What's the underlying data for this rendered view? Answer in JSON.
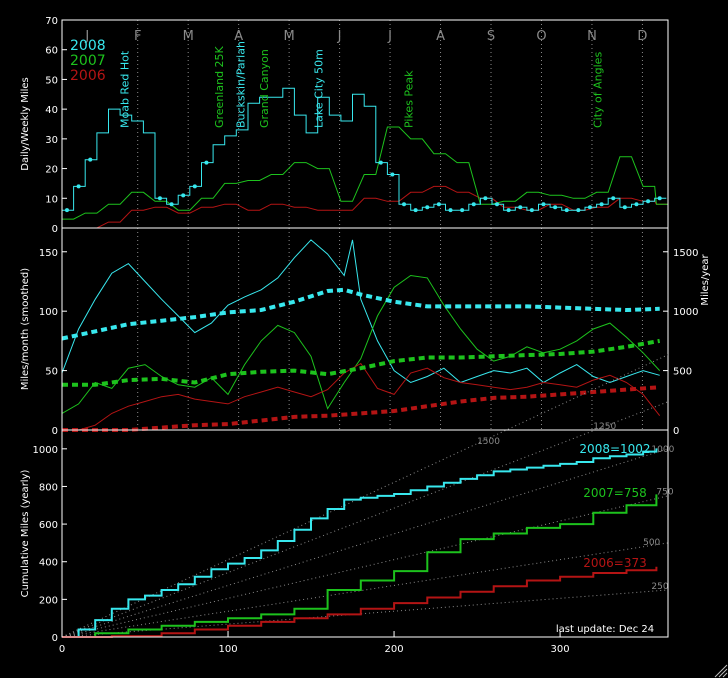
{
  "colors": {
    "background": "#000000",
    "axes": "#ffffff",
    "grid": "#8a8a8a",
    "y2008": "#38e8ee",
    "y2007": "#1dc21d",
    "y2006": "#b41414",
    "pace_lines": "#8a8a8a"
  },
  "panel1": {
    "ylabel": "Daily/Weekly Miles",
    "ylim": [
      0,
      70
    ],
    "yticks": [
      0,
      10,
      20,
      30,
      40,
      50,
      60,
      70
    ],
    "months": [
      "J",
      "F",
      "M",
      "A",
      "M",
      "J",
      "J",
      "A",
      "S",
      "O",
      "N",
      "D"
    ],
    "legend": [
      "2008",
      "2007",
      "2006"
    ],
    "events": [
      {
        "day": 40,
        "label": "Moab Red Hot",
        "year": "2008"
      },
      {
        "day": 97,
        "label": "Greenland 25K",
        "year": "2007"
      },
      {
        "day": 110,
        "label": "Buckskin/Pariah",
        "year": "2008"
      },
      {
        "day": 124,
        "label": "Grand Canyon",
        "year": "2007"
      },
      {
        "day": 157,
        "label": "Lake City 50m",
        "year": "2008"
      },
      {
        "day": 211,
        "label": "Pikes Peak",
        "year": "2007"
      },
      {
        "day": 325,
        "label": "City of Angles",
        "year": "2007"
      }
    ]
  },
  "panel2": {
    "ylabel": "Miles/month (smoothed)",
    "ylabel_right": "Miles/year",
    "ylim": [
      0,
      170
    ],
    "yticks": [
      0,
      50,
      100,
      150
    ],
    "ylim_right": [
      0,
      1700
    ],
    "yticks_right": [
      0,
      500,
      1000,
      1500
    ]
  },
  "panel3": {
    "ylabel": "Cumulative Miles (yearly)",
    "ylim": [
      0,
      1100
    ],
    "yticks": [
      0,
      200,
      400,
      600,
      800,
      1000
    ],
    "totals": [
      "2008=1002",
      "2007=758",
      "2006=373"
    ],
    "pace_labels": [
      "1500",
      "1250",
      "1000",
      "750",
      "500",
      "250"
    ],
    "update_text": "last update: Dec 24"
  },
  "xaxis": {
    "xlim": [
      0,
      365
    ],
    "xticks": [
      0,
      100,
      200,
      300
    ]
  },
  "chart_data": [
    {
      "type": "line",
      "ylabel": "Daily/Weekly Miles",
      "xlim": [
        0,
        365
      ],
      "ylim": [
        0,
        70
      ],
      "series": [
        {
          "name": "2008",
          "x": [
            0,
            7,
            14,
            21,
            28,
            35,
            42,
            49,
            56,
            63,
            70,
            77,
            84,
            91,
            98,
            105,
            112,
            119,
            126,
            133,
            140,
            147,
            154,
            161,
            168,
            175,
            182,
            189,
            196,
            203,
            210,
            217,
            224,
            231,
            238,
            245,
            252,
            259,
            266,
            273,
            280,
            287,
            294,
            301,
            308,
            315,
            322,
            329,
            336,
            343,
            350,
            357
          ],
          "values": [
            6,
            14,
            23,
            32,
            40,
            38,
            36,
            32,
            10,
            8,
            11,
            14,
            22,
            28,
            31,
            33,
            42,
            44,
            44,
            47,
            38,
            32,
            44,
            38,
            36,
            45,
            41,
            22,
            18,
            8,
            6,
            7,
            8,
            6,
            6,
            8,
            10,
            8,
            6,
            7,
            6,
            8,
            7,
            6,
            6,
            7,
            8,
            10,
            7,
            8,
            9,
            10
          ]
        },
        {
          "name": "2007",
          "x": [
            0,
            14,
            28,
            42,
            56,
            70,
            84,
            98,
            112,
            126,
            140,
            154,
            168,
            182,
            196,
            210,
            224,
            238,
            252,
            266,
            280,
            294,
            308,
            322,
            336,
            350,
            358
          ],
          "values": [
            3,
            5,
            8,
            12,
            9,
            6,
            10,
            15,
            16,
            18,
            22,
            20,
            9,
            18,
            34,
            30,
            25,
            22,
            8,
            9,
            12,
            11,
            10,
            12,
            24,
            14,
            8
          ]
        },
        {
          "name": "2006",
          "x": [
            0,
            14,
            28,
            42,
            56,
            70,
            84,
            98,
            112,
            126,
            140,
            154,
            168,
            182,
            196,
            210,
            224,
            238,
            252,
            266,
            280,
            294,
            308,
            322,
            336,
            350,
            358
          ],
          "values": [
            0,
            0,
            2,
            6,
            7,
            5,
            7,
            8,
            6,
            8,
            7,
            6,
            6,
            10,
            9,
            12,
            14,
            12,
            10,
            7,
            6,
            8,
            6,
            7,
            10,
            9,
            8
          ]
        }
      ]
    },
    {
      "type": "line",
      "ylabel": "Miles/month (smoothed)",
      "ylabel_right": "Miles/year",
      "xlim": [
        0,
        365
      ],
      "ylim": [
        0,
        170
      ],
      "series": [
        {
          "name": "2008",
          "x": [
            0,
            10,
            20,
            30,
            40,
            50,
            60,
            70,
            80,
            90,
            100,
            110,
            120,
            130,
            140,
            150,
            160,
            170,
            175,
            180,
            190,
            200,
            210,
            220,
            230,
            240,
            250,
            260,
            270,
            280,
            290,
            300,
            310,
            320,
            330,
            340,
            350,
            360
          ],
          "values": [
            48,
            85,
            110,
            132,
            140,
            125,
            110,
            96,
            82,
            90,
            105,
            112,
            118,
            128,
            145,
            160,
            148,
            130,
            160,
            110,
            75,
            50,
            40,
            45,
            52,
            40,
            45,
            50,
            48,
            52,
            40,
            48,
            55,
            45,
            40,
            45,
            50,
            46
          ]
        },
        {
          "name": "2007",
          "x": [
            0,
            10,
            20,
            30,
            40,
            50,
            60,
            70,
            80,
            90,
            100,
            110,
            120,
            130,
            140,
            150,
            160,
            170,
            180,
            190,
            200,
            210,
            220,
            230,
            240,
            250,
            260,
            270,
            280,
            290,
            300,
            310,
            320,
            330,
            340,
            350,
            360
          ],
          "values": [
            14,
            22,
            40,
            35,
            52,
            55,
            45,
            38,
            36,
            44,
            30,
            55,
            75,
            88,
            82,
            62,
            18,
            40,
            60,
            96,
            120,
            130,
            128,
            105,
            85,
            68,
            58,
            62,
            70,
            65,
            68,
            75,
            85,
            90,
            78,
            65,
            50
          ]
        },
        {
          "name": "2006",
          "x": [
            0,
            10,
            20,
            30,
            40,
            50,
            60,
            70,
            80,
            90,
            100,
            110,
            120,
            130,
            140,
            150,
            160,
            170,
            180,
            190,
            200,
            210,
            220,
            230,
            240,
            250,
            260,
            270,
            280,
            290,
            300,
            310,
            320,
            330,
            340,
            350,
            360
          ],
          "values": [
            0,
            0,
            4,
            14,
            20,
            24,
            28,
            30,
            26,
            24,
            22,
            28,
            32,
            36,
            32,
            28,
            34,
            48,
            56,
            35,
            30,
            48,
            52,
            44,
            40,
            38,
            36,
            34,
            36,
            40,
            38,
            36,
            42,
            46,
            40,
            30,
            12
          ]
        },
        {
          "name": "2008 pace",
          "x": [
            0,
            20,
            40,
            60,
            80,
            100,
            120,
            140,
            160,
            170,
            180,
            200,
            220,
            240,
            260,
            280,
            300,
            320,
            340,
            360
          ],
          "values": [
            77,
            83,
            89,
            92,
            95,
            99,
            101,
            108,
            117,
            118,
            114,
            108,
            104,
            104,
            104,
            104,
            103,
            102,
            101,
            102
          ]
        },
        {
          "name": "2007 pace",
          "x": [
            0,
            20,
            40,
            60,
            80,
            100,
            120,
            140,
            160,
            180,
            200,
            220,
            240,
            260,
            280,
            300,
            320,
            340,
            360
          ],
          "values": [
            38,
            38,
            42,
            43,
            40,
            47,
            49,
            50,
            47,
            52,
            58,
            61,
            61,
            62,
            63,
            64,
            66,
            70,
            75
          ]
        },
        {
          "name": "2006 pace",
          "x": [
            0,
            20,
            40,
            60,
            80,
            100,
            120,
            140,
            160,
            180,
            200,
            220,
            240,
            260,
            280,
            300,
            320,
            340,
            360
          ],
          "values": [
            0,
            0,
            0,
            2,
            4,
            5,
            8,
            11,
            12,
            14,
            16,
            20,
            24,
            27,
            28,
            30,
            32,
            34,
            36
          ]
        }
      ]
    },
    {
      "type": "line",
      "ylabel": "Cumulative Miles (yearly)",
      "xlim": [
        0,
        365
      ],
      "ylim": [
        0,
        1100
      ],
      "series": [
        {
          "name": "2008",
          "x": [
            0,
            10,
            20,
            30,
            40,
            50,
            60,
            70,
            80,
            90,
            100,
            110,
            120,
            130,
            140,
            150,
            160,
            170,
            180,
            190,
            200,
            210,
            220,
            230,
            240,
            250,
            260,
            270,
            280,
            290,
            300,
            310,
            320,
            330,
            340,
            350,
            358
          ],
          "values": [
            0,
            40,
            90,
            150,
            200,
            220,
            250,
            280,
            320,
            360,
            390,
            420,
            460,
            510,
            570,
            630,
            680,
            730,
            740,
            750,
            760,
            780,
            800,
            820,
            840,
            860,
            880,
            890,
            900,
            910,
            920,
            930,
            950,
            960,
            970,
            985,
            1002
          ]
        },
        {
          "name": "2007",
          "x": [
            0,
            20,
            40,
            60,
            80,
            100,
            120,
            140,
            160,
            180,
            200,
            220,
            240,
            260,
            280,
            300,
            320,
            340,
            358
          ],
          "values": [
            0,
            20,
            40,
            60,
            80,
            100,
            120,
            150,
            250,
            300,
            350,
            450,
            520,
            550,
            580,
            600,
            660,
            700,
            758
          ]
        },
        {
          "name": "2006",
          "x": [
            0,
            30,
            60,
            80,
            100,
            120,
            140,
            160,
            180,
            200,
            220,
            240,
            260,
            280,
            300,
            320,
            340,
            358
          ],
          "values": [
            0,
            5,
            20,
            40,
            60,
            80,
            100,
            120,
            150,
            180,
            210,
            240,
            270,
            300,
            320,
            340,
            355,
            373
          ]
        }
      ]
    }
  ]
}
